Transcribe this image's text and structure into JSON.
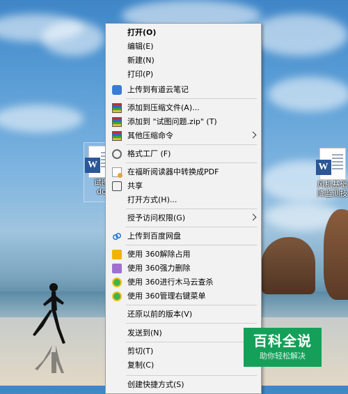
{
  "desktop": {
    "icon_left_label_line1": "试图",
    "icon_left_label_line2": "do",
    "icon_right_label_line1": "风机基础",
    "icon_right_label_line2": "降监测技"
  },
  "context_menu": {
    "items": [
      {
        "label": "打开(O)",
        "icon": "none"
      },
      {
        "label": "编辑(E)",
        "icon": "none"
      },
      {
        "label": "新建(N)",
        "icon": "none"
      },
      {
        "label": "打印(P)",
        "icon": "none"
      },
      {
        "label": "上传到有道云笔记",
        "icon": "youdao-note-icon"
      },
      {
        "label": "添加到压缩文件(A)...",
        "icon": "winrar-icon"
      },
      {
        "label": "添加到 \"试图问题.zip\" (T)",
        "icon": "winrar-icon"
      },
      {
        "label": "其他压缩命令",
        "icon": "winrar-icon"
      },
      {
        "label": "格式工厂 (F)",
        "icon": "format-factory-icon"
      },
      {
        "label": "在福昕阅读器中转换成PDF",
        "icon": "pdf-icon"
      },
      {
        "label": "共享",
        "icon": "share-icon"
      },
      {
        "label": "打开方式(H)...",
        "icon": "none"
      },
      {
        "label": "授予访问权限(G)",
        "icon": "none"
      },
      {
        "label": "上传到百度网盘",
        "icon": "baidu-cloud-icon"
      },
      {
        "label": "使用 360解除占用",
        "icon": "360-unlock-icon"
      },
      {
        "label": "使用 360强力删除",
        "icon": "360-delete-icon"
      },
      {
        "label": "使用 360进行木马云查杀",
        "icon": "360-scan-icon"
      },
      {
        "label": "使用 360管理右键菜单",
        "icon": "360-manage-icon"
      },
      {
        "label": "还原以前的版本(V)",
        "icon": "none"
      },
      {
        "label": "发送到(N)",
        "icon": "none"
      },
      {
        "label": "剪切(T)",
        "icon": "none"
      },
      {
        "label": "复制(C)",
        "icon": "none"
      },
      {
        "label": "创建快捷方式(S)",
        "icon": "none"
      }
    ]
  },
  "watermark": {
    "title": "百科全说",
    "subtitle": "助你轻松解决"
  },
  "colors": {
    "menu_bg": "#f2f2f2",
    "watermark_green": "#15a05a",
    "word_blue": "#2b5797"
  }
}
